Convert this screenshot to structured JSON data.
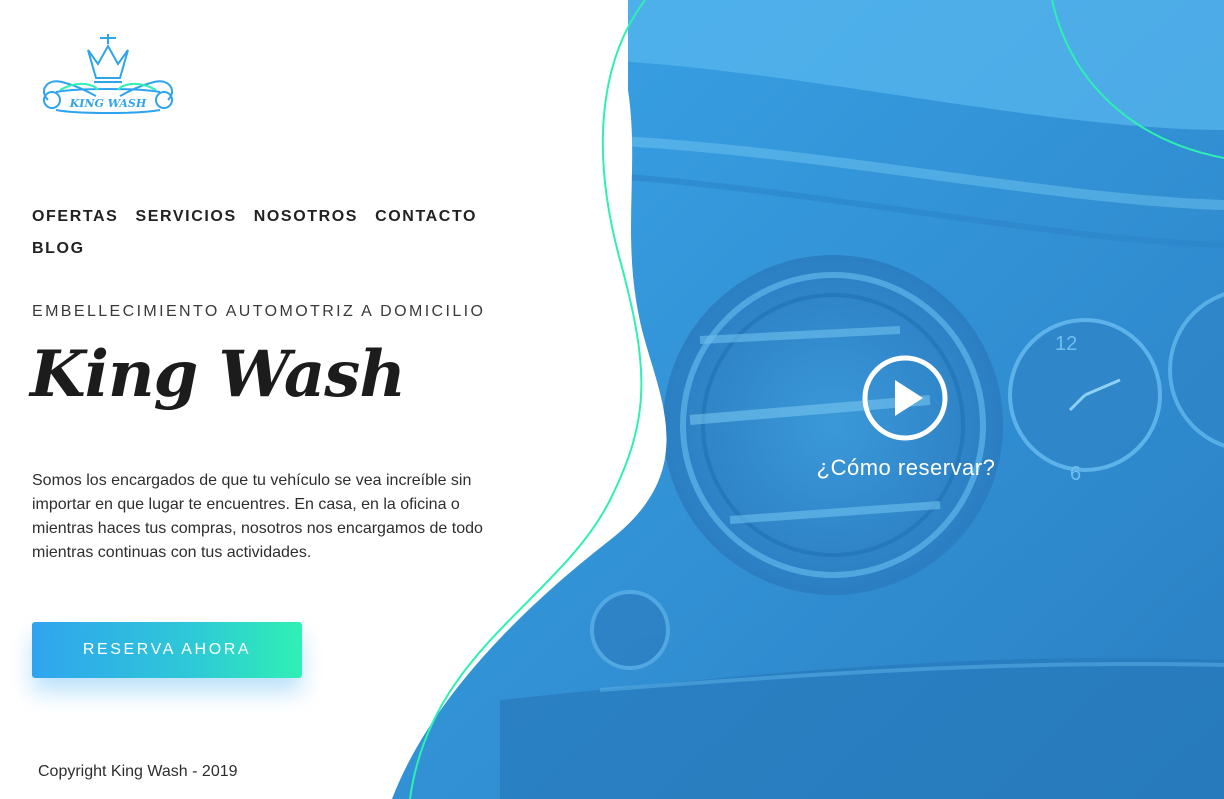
{
  "logo": {
    "text": "KING WASH",
    "icon": "crown-logo-icon"
  },
  "nav": {
    "items": [
      {
        "label": "OFERTAS"
      },
      {
        "label": "SERVICIOS"
      },
      {
        "label": "NOSOTROS"
      },
      {
        "label": "CONTACTO"
      },
      {
        "label": "BLOG"
      }
    ]
  },
  "hero": {
    "tagline": "EMBELLECIMIENTO AUTOMOTRIZ A DOMICILIO",
    "title": "King Wash",
    "description": "Somos los encargados de que tu vehículo se vea increíble sin importar en que lugar te encuentres. En casa, en la oficina o mientras haces tus compras, nosotros nos encargamos de todo mientras continuas con tus actividades.",
    "cta_label": "RESERVA AHORA",
    "video_label": "¿Cómo reservar?"
  },
  "footer": {
    "copyright": "Copyright King Wash - 2019"
  },
  "colors": {
    "primary_blue": "#2f8fd6",
    "accent_green": "#2ff0b4",
    "accent_light_blue": "#2fa4ee",
    "text_dark": "#222222"
  }
}
